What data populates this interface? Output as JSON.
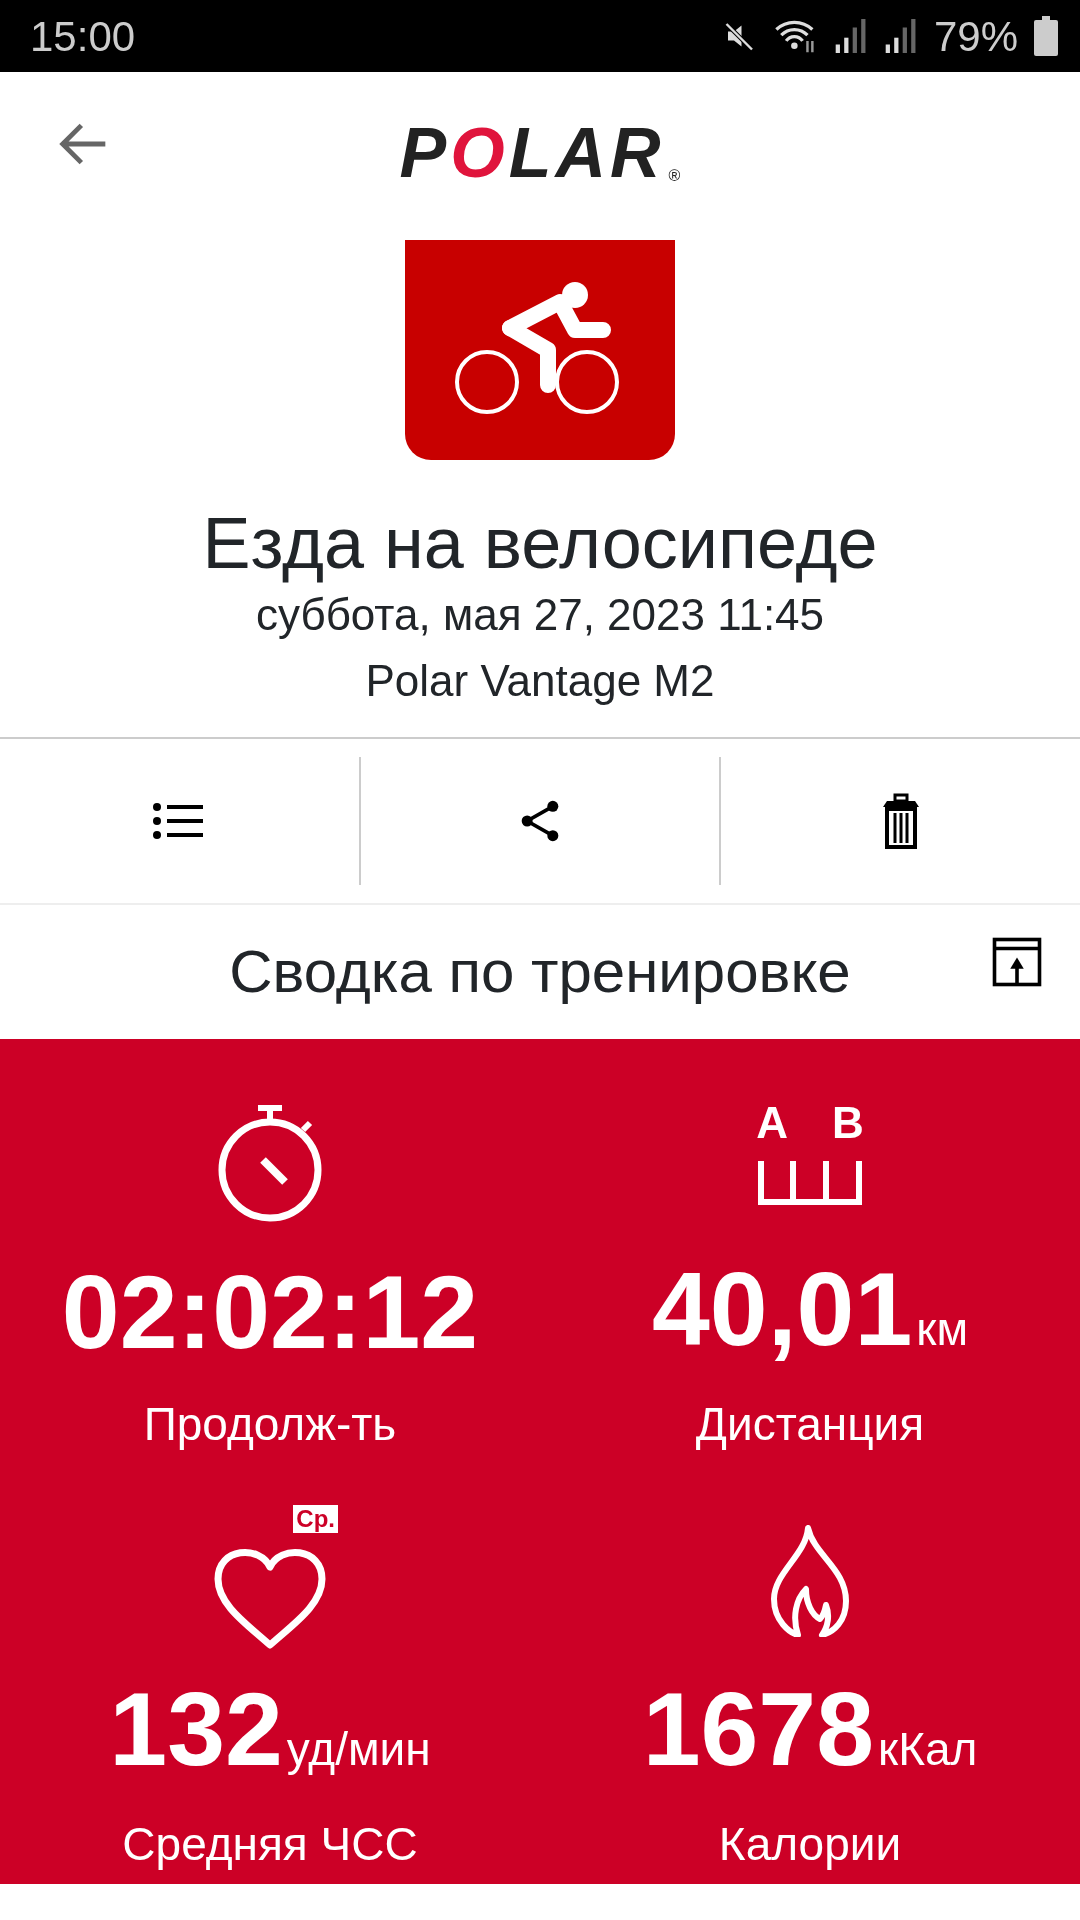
{
  "status_bar": {
    "time": "15:00",
    "battery": "79%"
  },
  "header": {
    "logo": "POLAR",
    "logo_mark": "®"
  },
  "activity": {
    "title": "Езда на велосипеде",
    "datetime": "суббота, мая 27, 2023 11:45",
    "device": "Polar Vantage M2"
  },
  "summary": {
    "title": "Сводка по тренировке"
  },
  "metrics": [
    {
      "kind": "duration",
      "value": "02:02:12",
      "label": "Продолж-ть"
    },
    {
      "kind": "distance",
      "icon_labels": [
        "A",
        "B"
      ],
      "value": "40,01",
      "unit": "км",
      "label": "Дистанция"
    },
    {
      "kind": "heart_rate",
      "badge": "Ср.",
      "value": "132",
      "unit": "уд/мин",
      "label": "Средняя ЧСС"
    },
    {
      "kind": "calories",
      "value": "1678",
      "unit": "кКал",
      "label": "Калории"
    }
  ]
}
